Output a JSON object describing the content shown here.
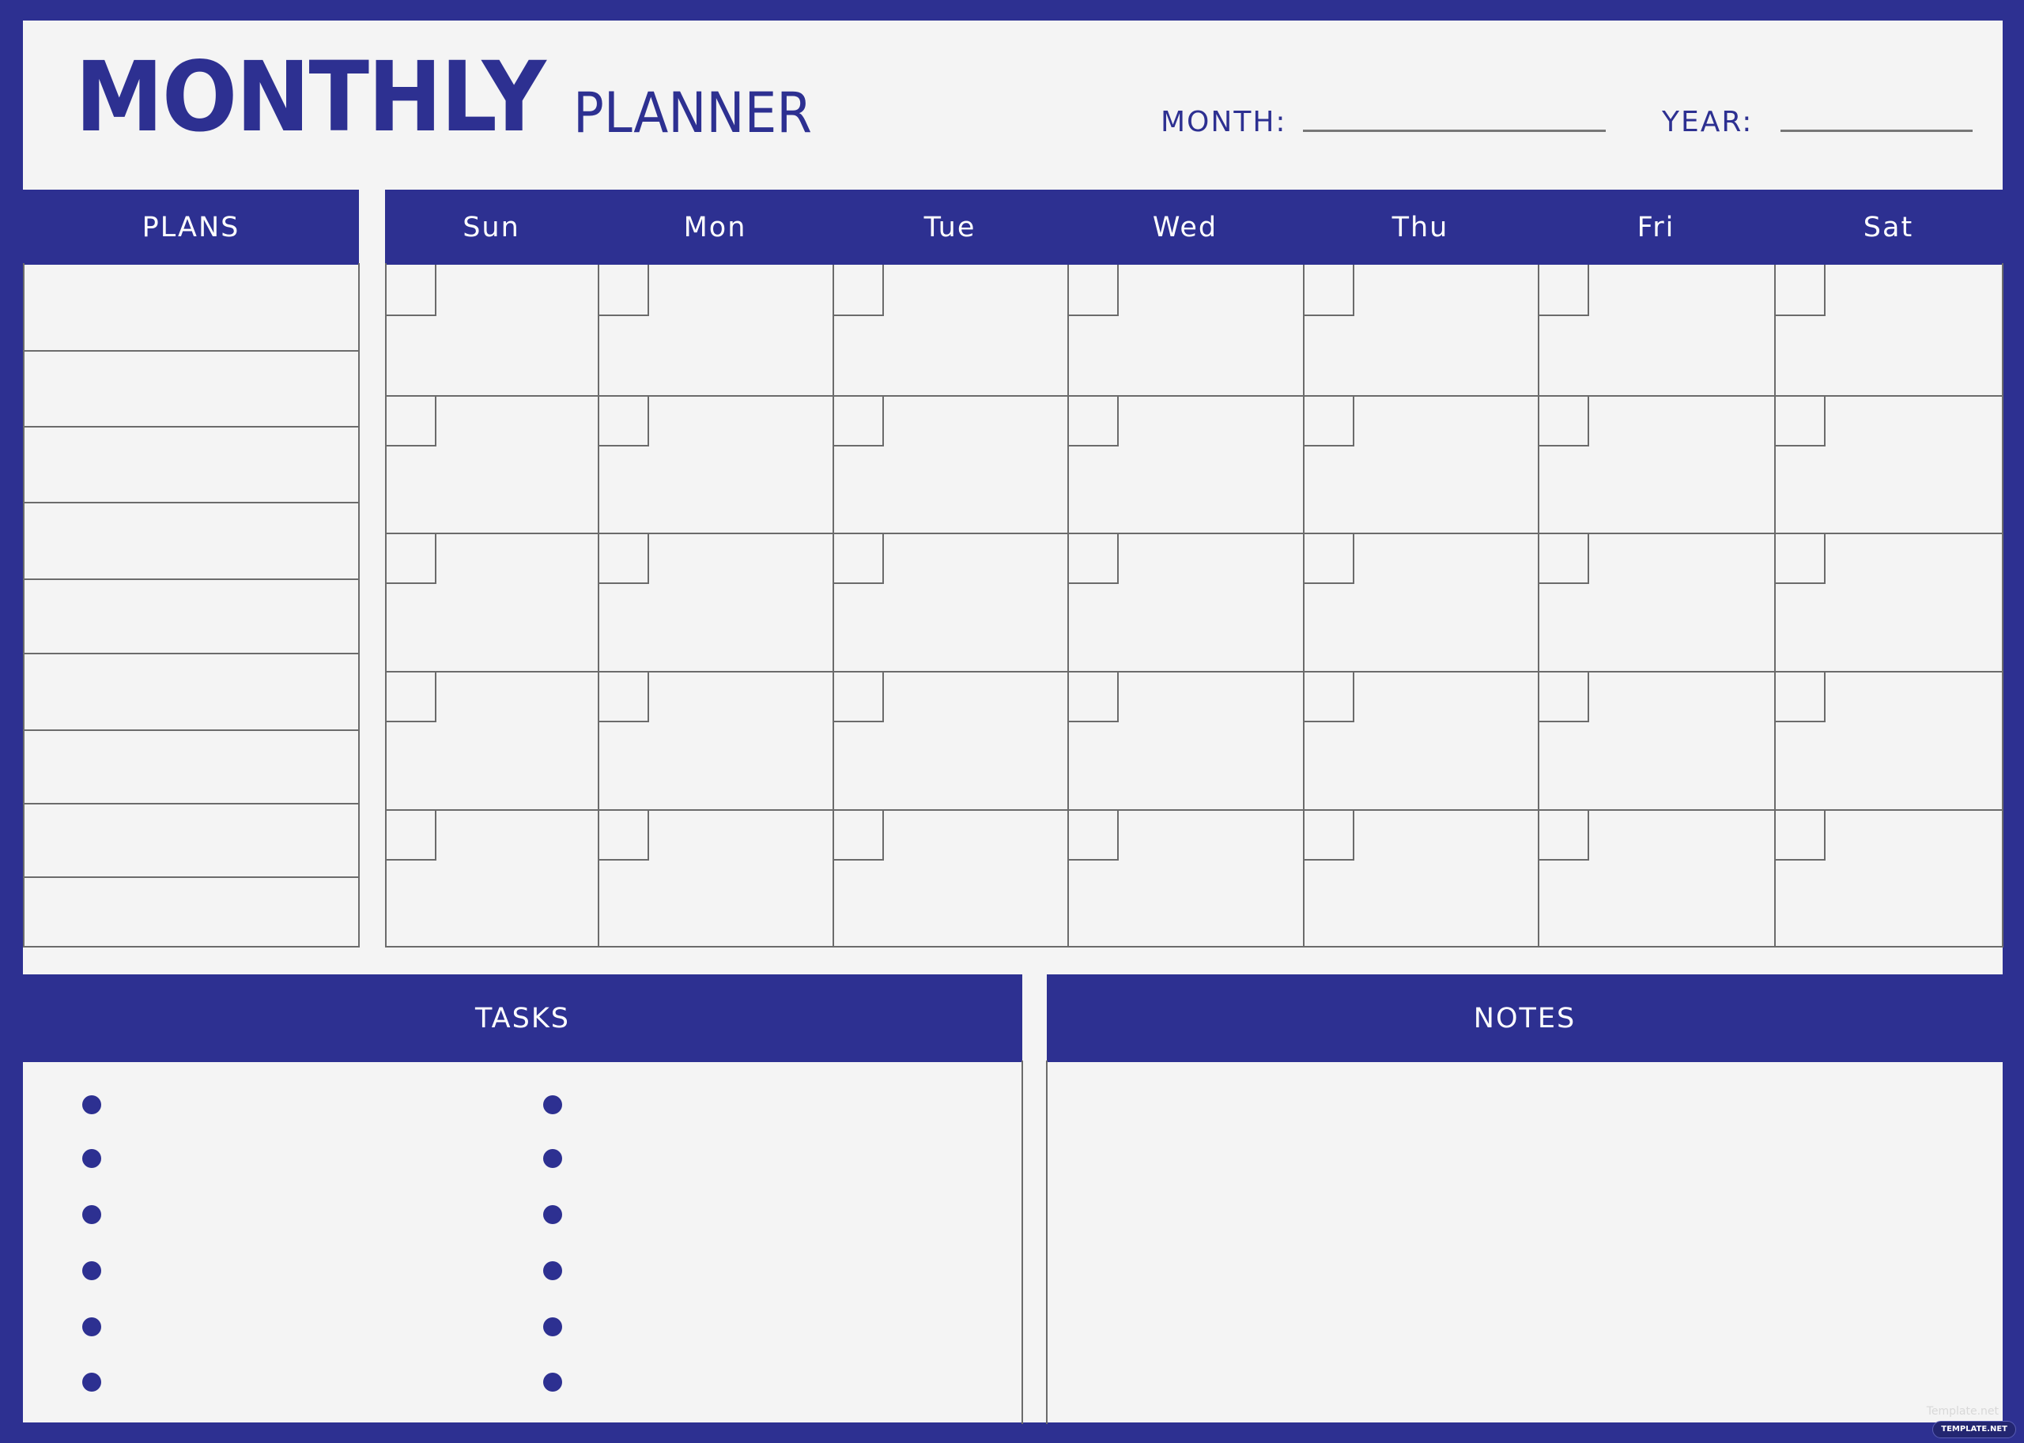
{
  "colors": {
    "frame": "#2d3091",
    "panel": "#f4f4f4",
    "lines": "#6b6b6b",
    "header_text": "#ffffff"
  },
  "header": {
    "title_main": "MONTHLY",
    "title_sub": "PLANNER",
    "month_label": "MONTH:",
    "month_value": "",
    "year_label": "YEAR:",
    "year_value": ""
  },
  "plans": {
    "title": "PLANS",
    "rows": 9
  },
  "calendar": {
    "days": [
      "Sun",
      "Mon",
      "Tue",
      "Wed",
      "Thu",
      "Fri",
      "Sat"
    ],
    "weeks": 5
  },
  "tasks": {
    "title": "TASKS",
    "columns": 2,
    "bullets_per_column": 6
  },
  "notes": {
    "title": "NOTES"
  },
  "watermark": {
    "text": "Template.net",
    "badge": "TEMPLATE.NET"
  }
}
